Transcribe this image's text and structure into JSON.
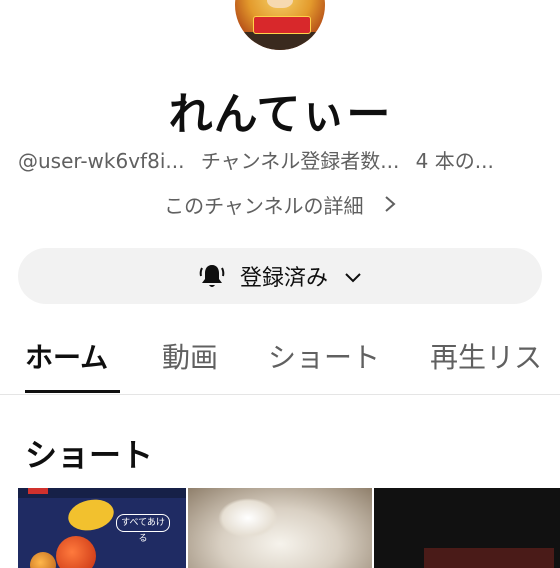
{
  "channel": {
    "name": "れんてぃー",
    "handle": "@user-wk6vf8i...",
    "subscribers": "チャンネル登録者数...",
    "video_count": "4 本の...",
    "details_link": "このチャンネルの詳細"
  },
  "subscribe": {
    "label": "登録済み",
    "icon": "bell-icon"
  },
  "tabs": [
    {
      "label": "ホーム",
      "active": true
    },
    {
      "label": "動画",
      "active": false
    },
    {
      "label": "ショート",
      "active": false
    },
    {
      "label": "再生リス",
      "active": false
    }
  ],
  "section": {
    "title": "ショート"
  },
  "shorts": [
    {
      "badge": "すべてあける"
    },
    {
      "badge": ""
    },
    {
      "badge": ""
    }
  ],
  "colors": {
    "text": "#0f0f0f",
    "secondary": "#606060",
    "chip_bg": "#f2f2f2"
  }
}
